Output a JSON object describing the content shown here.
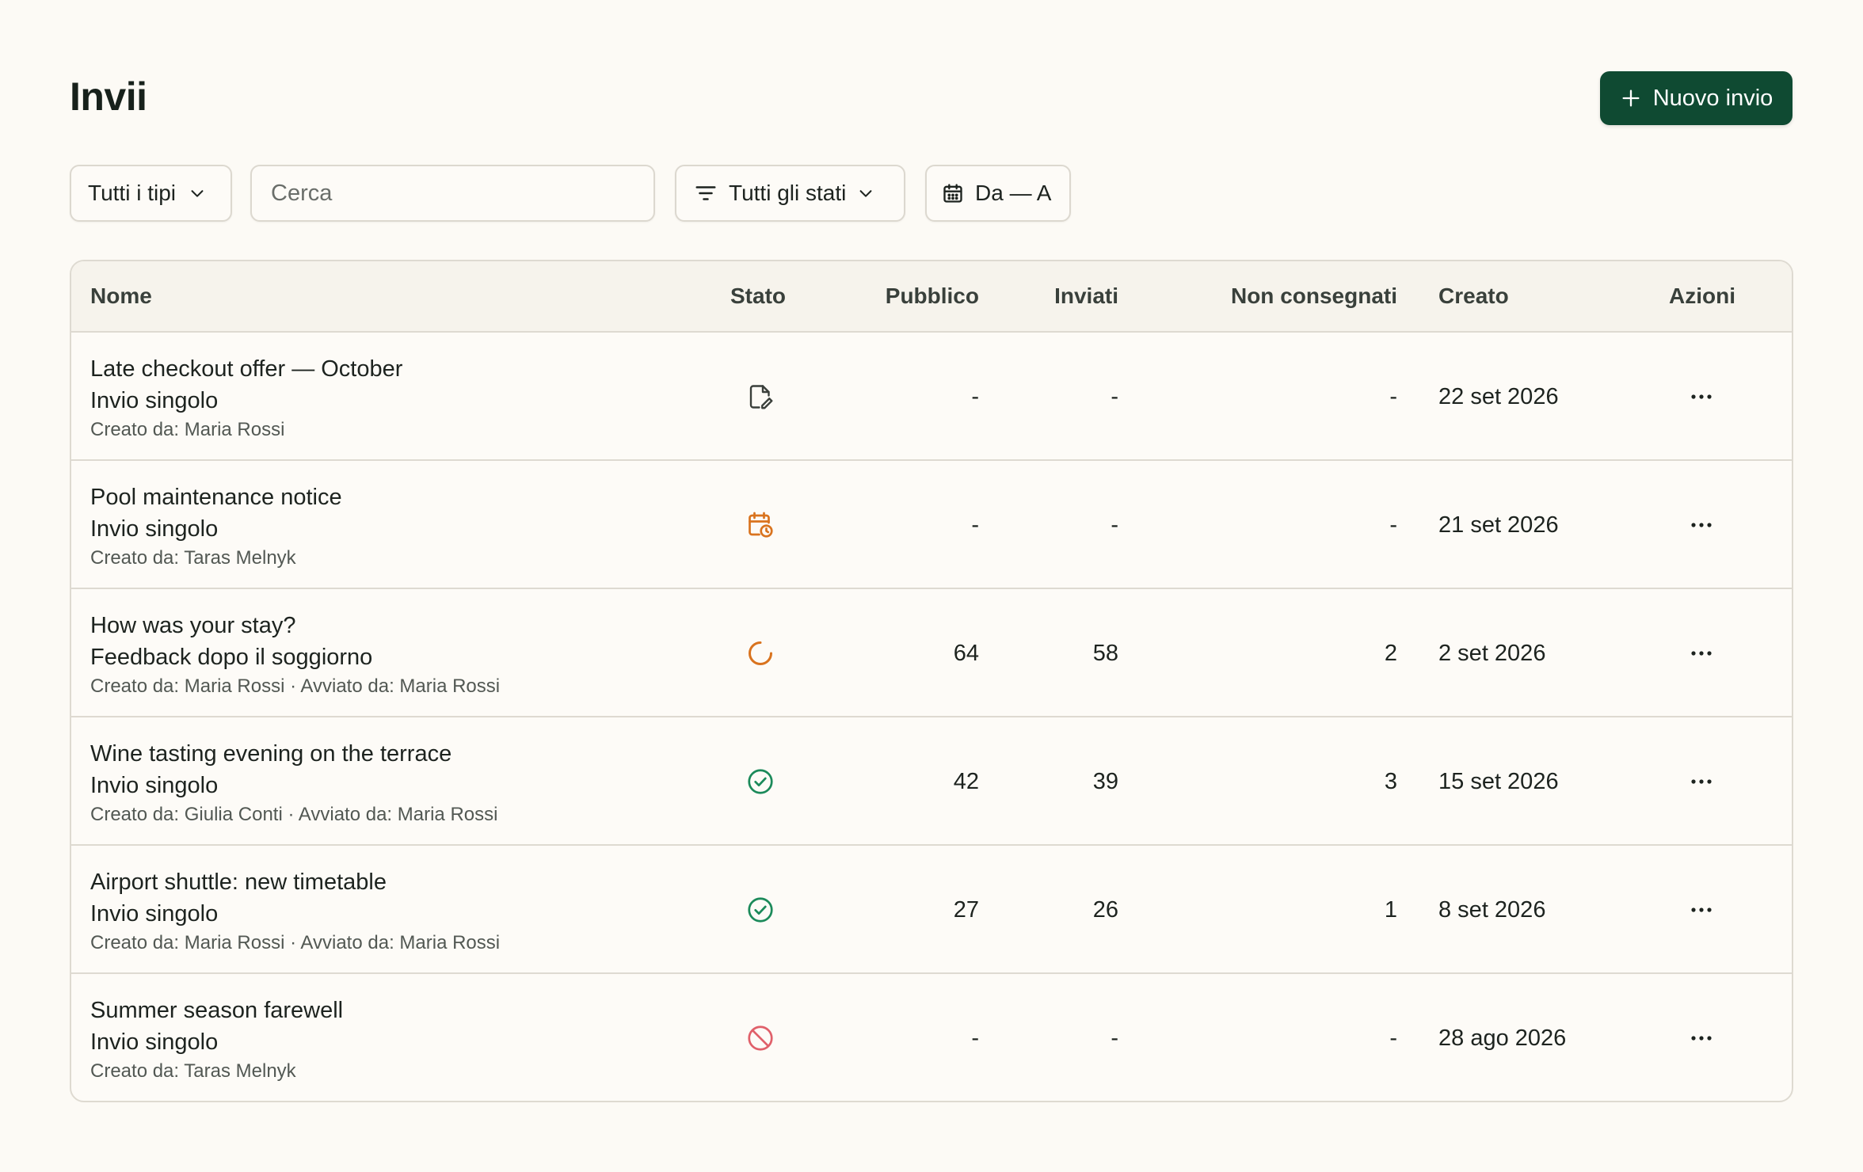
{
  "page": {
    "title": "Invii"
  },
  "header": {
    "new_button_label": "Nuovo invio"
  },
  "filters": {
    "types_label": "Tutti i tipi",
    "search_placeholder": "Cerca",
    "states_label": "Tutti gli stati",
    "dates_label": "Da — A"
  },
  "table": {
    "columns": {
      "name": "Nome",
      "status": "Stato",
      "audience": "Pubblico",
      "sent": "Inviati",
      "undelivered": "Non consegnati",
      "created": "Creato",
      "actions": "Azioni"
    },
    "rows": [
      {
        "title": "Late checkout offer — October",
        "type": "Invio singolo",
        "meta": "Creato da: Maria Rossi",
        "status_icon": "draft-icon",
        "audience": "-",
        "sent": "-",
        "undelivered": "-",
        "created": "22 set 2026"
      },
      {
        "title": "Pool maintenance notice",
        "type": "Invio singolo",
        "meta": "Creato da: Taras Melnyk",
        "status_icon": "scheduled-calendar-icon",
        "audience": "-",
        "sent": "-",
        "undelivered": "-",
        "created": "21 set 2026"
      },
      {
        "title": "How was your stay?",
        "type": "Feedback dopo il soggiorno",
        "meta": "Creato da: Maria Rossi · Avviato da: Maria Rossi",
        "status_icon": "in-progress-spinner-icon",
        "audience": "64",
        "sent": "58",
        "undelivered": "2",
        "created": "2 set 2026"
      },
      {
        "title": "Wine tasting evening on the terrace",
        "type": "Invio singolo",
        "meta": "Creato da: Giulia Conti · Avviato da: Maria Rossi",
        "status_icon": "completed-check-icon",
        "audience": "42",
        "sent": "39",
        "undelivered": "3",
        "created": "15 set 2026"
      },
      {
        "title": "Airport shuttle: new timetable",
        "type": "Invio singolo",
        "meta": "Creato da: Maria Rossi · Avviato da: Maria Rossi",
        "status_icon": "completed-check-icon",
        "audience": "27",
        "sent": "26",
        "undelivered": "1",
        "created": "8 set 2026"
      },
      {
        "title": "Summer season farewell",
        "type": "Invio singolo",
        "meta": "Creato da: Taras Melnyk",
        "status_icon": "cancelled-icon",
        "audience": "-",
        "sent": "-",
        "undelivered": "-",
        "created": "28 ago 2026"
      }
    ]
  },
  "colors": {
    "primary": "#0f4a32",
    "background": "#fcfaf5",
    "draft": "#3a3f3b",
    "scheduled": "#d9731e",
    "in_progress": "#d9731e",
    "completed": "#1b8a5a",
    "cancelled": "#e0606a"
  }
}
